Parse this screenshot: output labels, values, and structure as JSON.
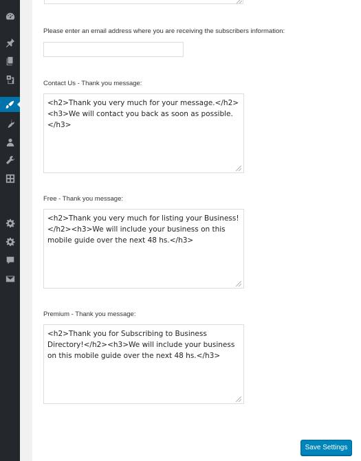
{
  "sidebar": {
    "items": [
      {
        "name": "dashboard-icon"
      },
      {
        "name": "pin-icon"
      },
      {
        "name": "pages-icon"
      },
      {
        "name": "media-icon"
      },
      {
        "name": "appearance-icon",
        "active": true
      },
      {
        "name": "plugins-icon"
      },
      {
        "name": "users-icon"
      },
      {
        "name": "tools-icon"
      },
      {
        "name": "settings-grid-icon"
      },
      {
        "name": "gear-icon"
      },
      {
        "name": "gear-icon"
      },
      {
        "name": "comment-icon"
      },
      {
        "name": "mail-icon"
      }
    ],
    "active_color": "#0073aa",
    "background": "#23282d"
  },
  "form": {
    "email_label": "Please enter an email address where you are receiving the subscribers information:",
    "email_value": "",
    "contact_label": "Contact Us - Thank you message:",
    "contact_value": "<h2>Thank you very much for your message.</h2><h3>We will contact you back as soon as possible.</h3>",
    "free_label": "Free - Thank you message:",
    "free_value": "<h2>Thank you very much for listing your Business!</h2><h3>We will include your business on this mobile guide over the next 48 hs.</h3>",
    "premium_label": "Premium - Thank you message:",
    "premium_value": "<h2>Thank you for Subscribing to Business Directory!</h2><h3>We will include your business on this mobile guide over the next 48 hs.</h3>"
  },
  "actions": {
    "save_label": "Save Settings",
    "button_color": "#0085ba"
  }
}
